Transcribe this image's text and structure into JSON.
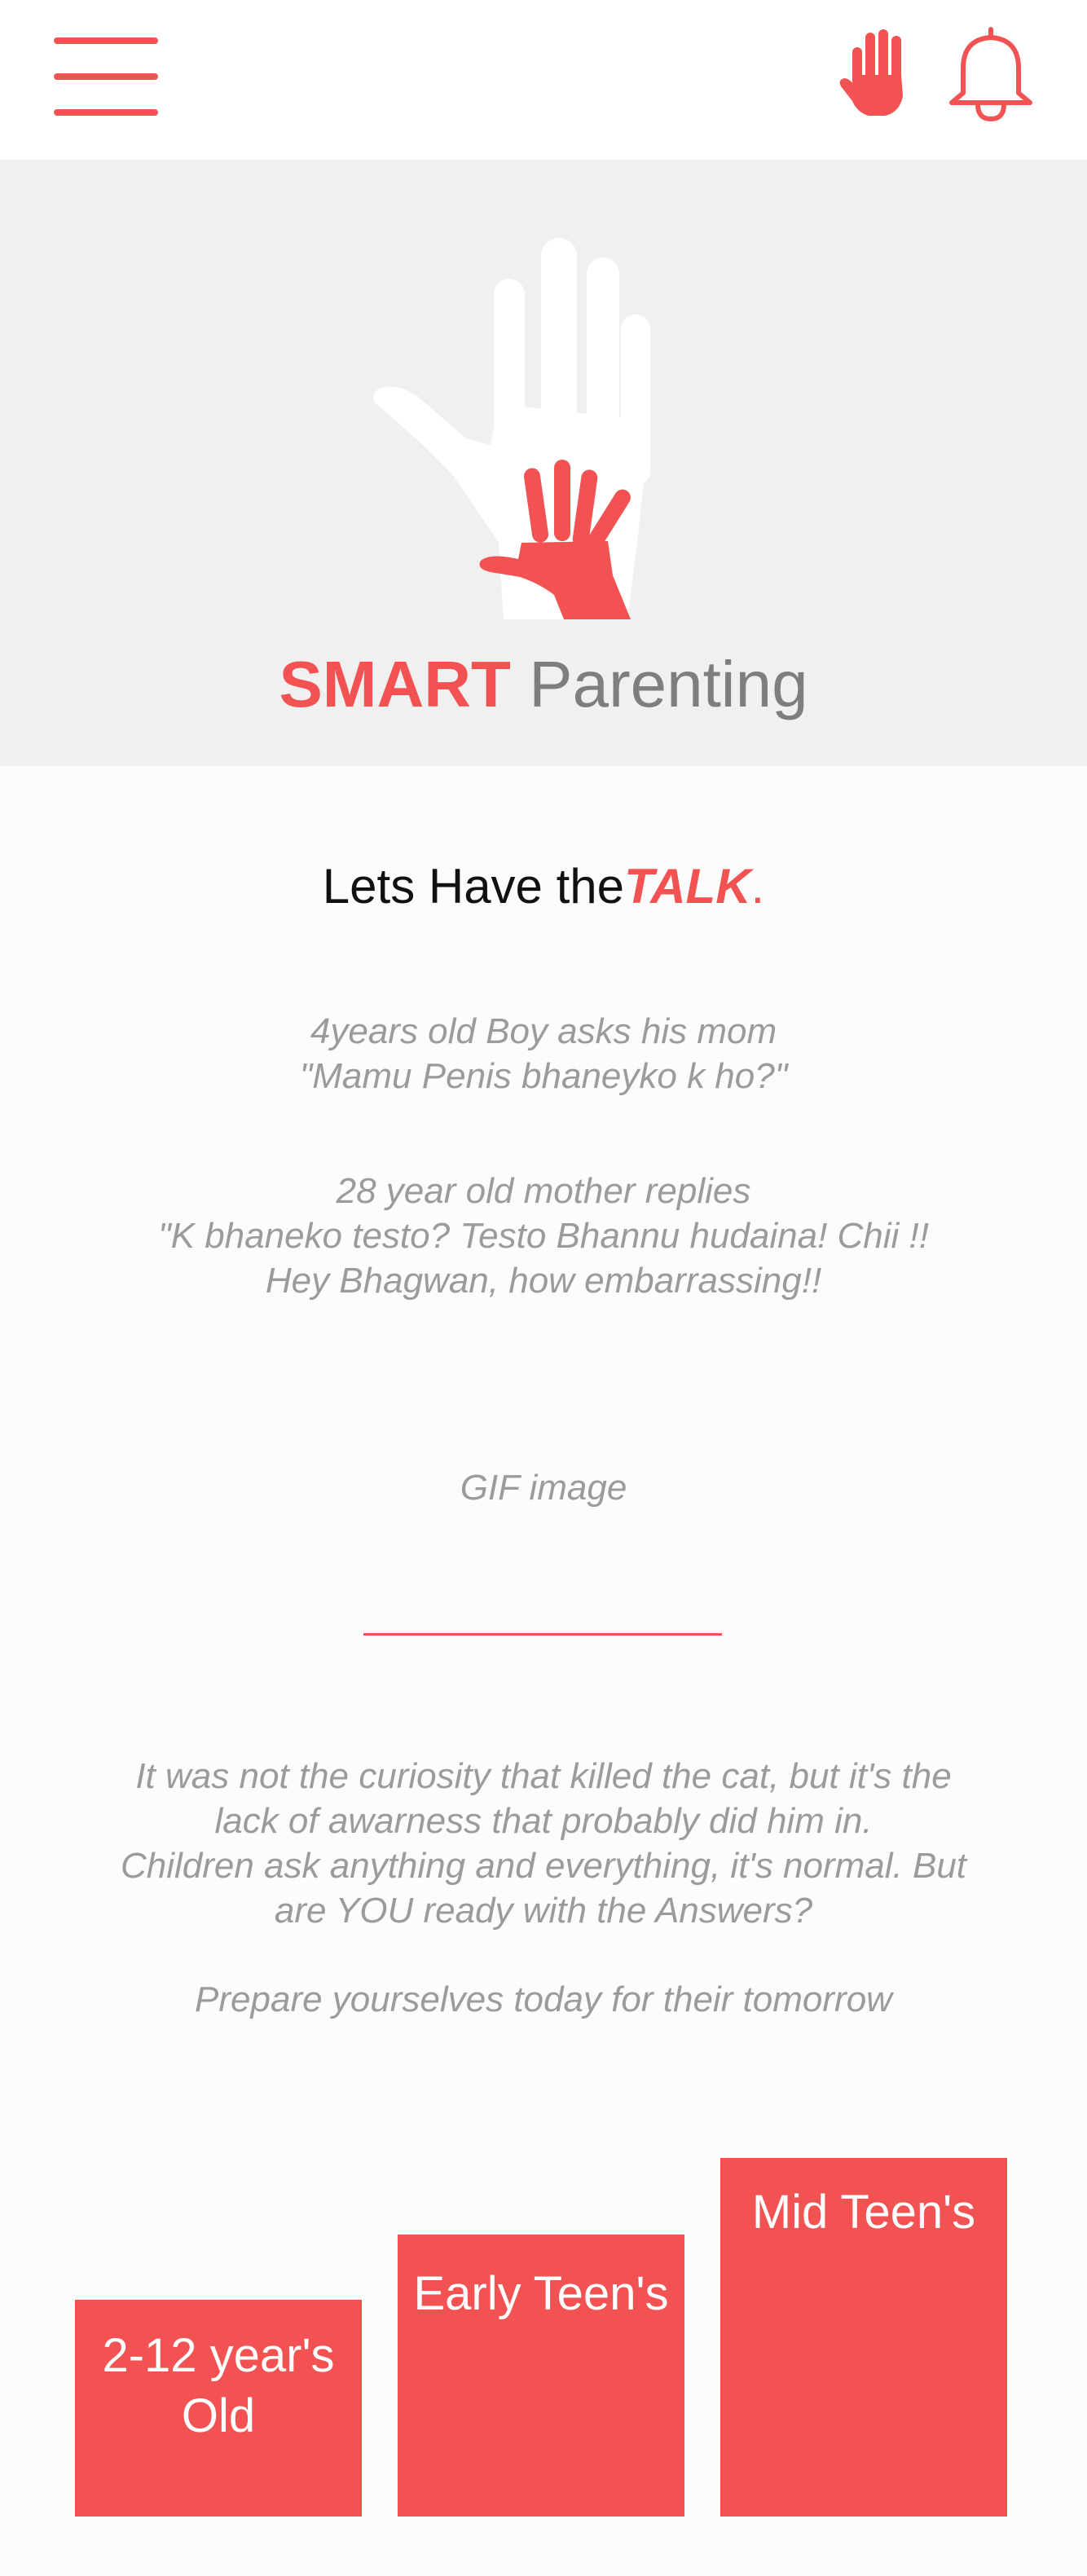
{
  "header": {
    "menu_icon": "hamburger-menu-icon",
    "hand_icon": "raised-hand-icon",
    "bell_icon": "notification-bell-icon",
    "accent_color": "#f25252"
  },
  "hero": {
    "logo_icon": "adult-and-child-hands-logo",
    "brand_bold": "SMART",
    "brand_regular": "Parenting"
  },
  "intro": {
    "heading_prefix": "Lets Have the",
    "heading_emph": "TALK",
    "heading_suffix": "."
  },
  "story": {
    "child_lines": [
      "4years old Boy asks his mom",
      "\"Mamu Penis bhaneyko k ho?\""
    ],
    "mother_lines": [
      "28 year old mother replies",
      "\"K bhaneko testo? Testo Bhannu hudaina! Chii !!",
      "Hey Bhagwan, how embarrassing!!"
    ],
    "gif_placeholder": "GIF image"
  },
  "message": {
    "lines": [
      "It was not the curiosity that killed the cat, but it's the",
      "lack of awarness that probably did him in.",
      "Children ask anything and everything, it's normal. But",
      "are YOU ready with the Answers?"
    ],
    "tagline": "Prepare yourselves today for their tomorrow"
  },
  "age_groups": [
    {
      "label_line1": "2-12 year's",
      "label_line2": "Old"
    },
    {
      "label_line1": "Early Teen's"
    },
    {
      "label_line1": "Mid Teen's"
    }
  ]
}
